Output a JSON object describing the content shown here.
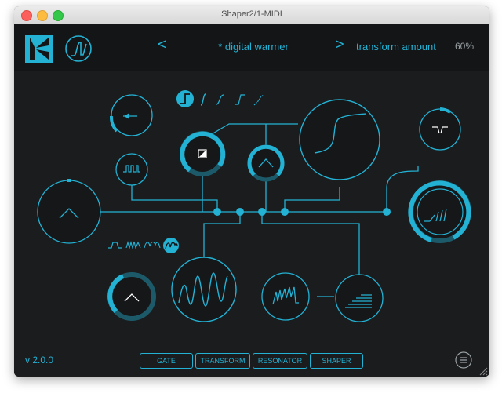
{
  "window": {
    "title": "Shaper2/1-MIDI"
  },
  "header": {
    "prev_label": "<",
    "next_label": ">",
    "preset_name": "* digital warmer",
    "transform_label": "transform amount",
    "transform_value": "60%"
  },
  "footer": {
    "version": "v 2.0.0",
    "tabs": [
      "GATE",
      "TRANSFORM",
      "RESONATOR",
      "SHAPER"
    ]
  },
  "colors": {
    "accent": "#23b2d4",
    "background": "#1b1c1e",
    "header": "#141517"
  }
}
